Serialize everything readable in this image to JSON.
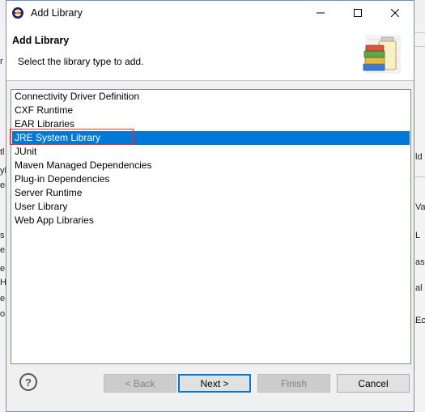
{
  "window": {
    "title": "Add Library",
    "controls": {
      "minimize": "minimize",
      "maximize": "maximize",
      "close": "close"
    }
  },
  "banner": {
    "title": "Add Library",
    "description": "Select the library type to add.",
    "image": "library-books-jar-icon"
  },
  "library_types": [
    {
      "label": "Connectivity Driver Definition",
      "selected": false
    },
    {
      "label": "CXF Runtime",
      "selected": false
    },
    {
      "label": "EAR Libraries",
      "selected": false
    },
    {
      "label": "JRE System Library",
      "selected": true
    },
    {
      "label": "JUnit",
      "selected": false
    },
    {
      "label": "Maven Managed Dependencies",
      "selected": false
    },
    {
      "label": "Plug-in Dependencies",
      "selected": false
    },
    {
      "label": "Server Runtime",
      "selected": false
    },
    {
      "label": "User Library",
      "selected": false
    },
    {
      "label": "Web App Libraries",
      "selected": false
    }
  ],
  "buttons": {
    "help": "?",
    "back": "< Back",
    "next": "Next >",
    "finish": "Finish",
    "cancel": "Cancel"
  },
  "background": {
    "left_fragments": [
      "r",
      "tl",
      "yl",
      "er",
      "s",
      "e",
      "e",
      "Hi",
      "e",
      "o"
    ],
    "right_fragments": [
      "ld",
      "Va",
      "L",
      "as",
      "al",
      "Ec"
    ]
  },
  "colors": {
    "selection": "#0078d7",
    "annotation_box": "#d9363e",
    "default_button_border": "#0078d7"
  }
}
